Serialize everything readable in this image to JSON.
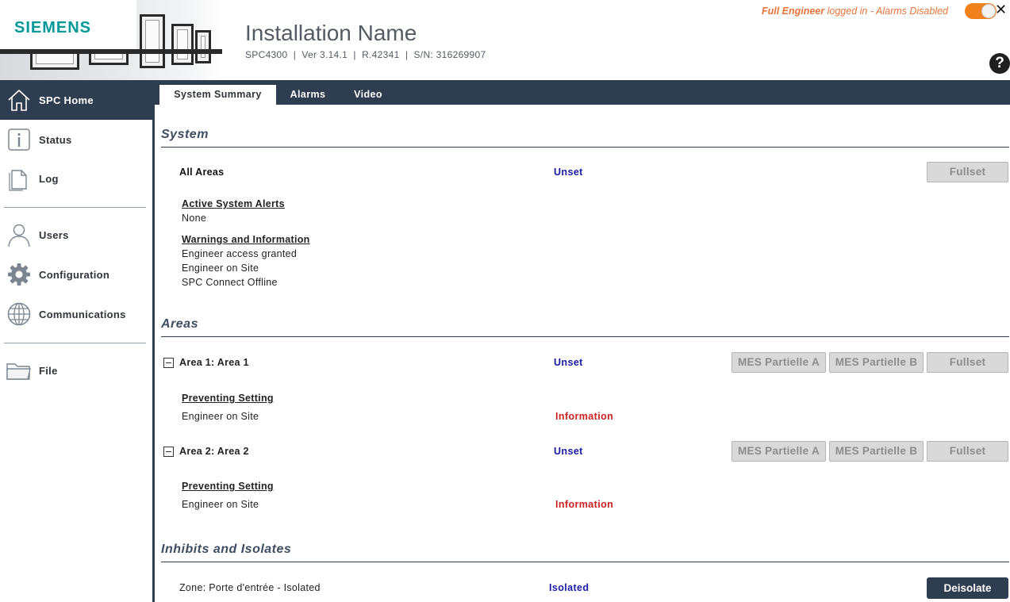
{
  "header": {
    "brand": "SIEMENS",
    "installation_name": "Installation Name",
    "details": "SPC4300  |  Ver 3.14.1  |  R.42341  |  S/N: 316269907",
    "login_user": "Full Engineer",
    "login_suffix": " logged in - Alarms Disabled",
    "help_glyph": "?",
    "toggle_glyph": "✕"
  },
  "sidebar": {
    "items": [
      {
        "label": "SPC Home",
        "icon": "home-icon"
      },
      {
        "label": "Status",
        "icon": "info-icon"
      },
      {
        "label": "Log",
        "icon": "document-icon"
      },
      {
        "label": "Users",
        "icon": "user-icon"
      },
      {
        "label": "Configuration",
        "icon": "gear-icon"
      },
      {
        "label": "Communications",
        "icon": "globe-icon"
      },
      {
        "label": "File",
        "icon": "folder-icon"
      }
    ]
  },
  "tabs": [
    {
      "label": "System Summary",
      "active": true
    },
    {
      "label": "Alarms",
      "active": false
    },
    {
      "label": "Video",
      "active": false
    }
  ],
  "system": {
    "title": "System",
    "all_areas_label": "All Areas",
    "all_areas_status": "Unset",
    "fullset_label": "Fullset",
    "alerts_heading": "Active System Alerts",
    "alerts_value": "None",
    "warnings_heading": "Warnings and Information",
    "warnings": [
      "Engineer access granted",
      "Engineer on Site",
      "SPC Connect Offline"
    ]
  },
  "areas": {
    "title": "Areas",
    "list": [
      {
        "name": "Area 1: Area 1",
        "status": "Unset",
        "buttons": [
          "MES Partielle A",
          "MES Partielle B",
          "Fullset"
        ],
        "heading": "Preventing Setting",
        "reason": "Engineer on Site",
        "reason_status": "Information"
      },
      {
        "name": "Area 2: Area 2",
        "status": "Unset",
        "buttons": [
          "MES Partielle A",
          "MES Partielle B",
          "Fullset"
        ],
        "heading": "Preventing Setting",
        "reason": "Engineer on Site",
        "reason_status": "Information"
      }
    ]
  },
  "inhibits": {
    "title": "Inhibits and Isolates",
    "zone_label": "Zone: Porte d'entrée - Isolated",
    "zone_status": "Isolated",
    "deisolate_label": "Deisolate"
  },
  "colors": {
    "navy": "#2e3d50",
    "brand_teal": "#009999",
    "status_blue": "#1a1aa6",
    "status_red": "#cc2222",
    "login_orange": "#e8743b"
  }
}
